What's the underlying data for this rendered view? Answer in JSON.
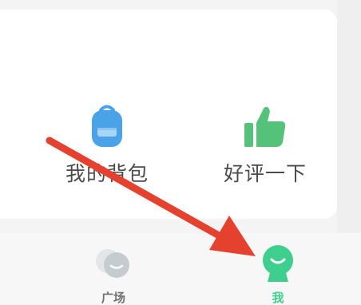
{
  "grid": {
    "items": [
      {
        "label": "我的背包",
        "icon": "backpack-icon",
        "color": "#4aa3e6"
      },
      {
        "label": "好评一下",
        "icon": "thumbs-up-icon",
        "color": "#55c27a"
      }
    ]
  },
  "tabbar": {
    "tabs": [
      {
        "label": "广场",
        "icon": "square-chat-icon",
        "active": false,
        "color": "#b9c1c6"
      },
      {
        "label": "我",
        "icon": "me-icon",
        "active": true,
        "color": "#3ecf8e"
      }
    ]
  },
  "annotation": {
    "type": "arrow",
    "color": "#e4412f",
    "points_to": "tab-me"
  }
}
